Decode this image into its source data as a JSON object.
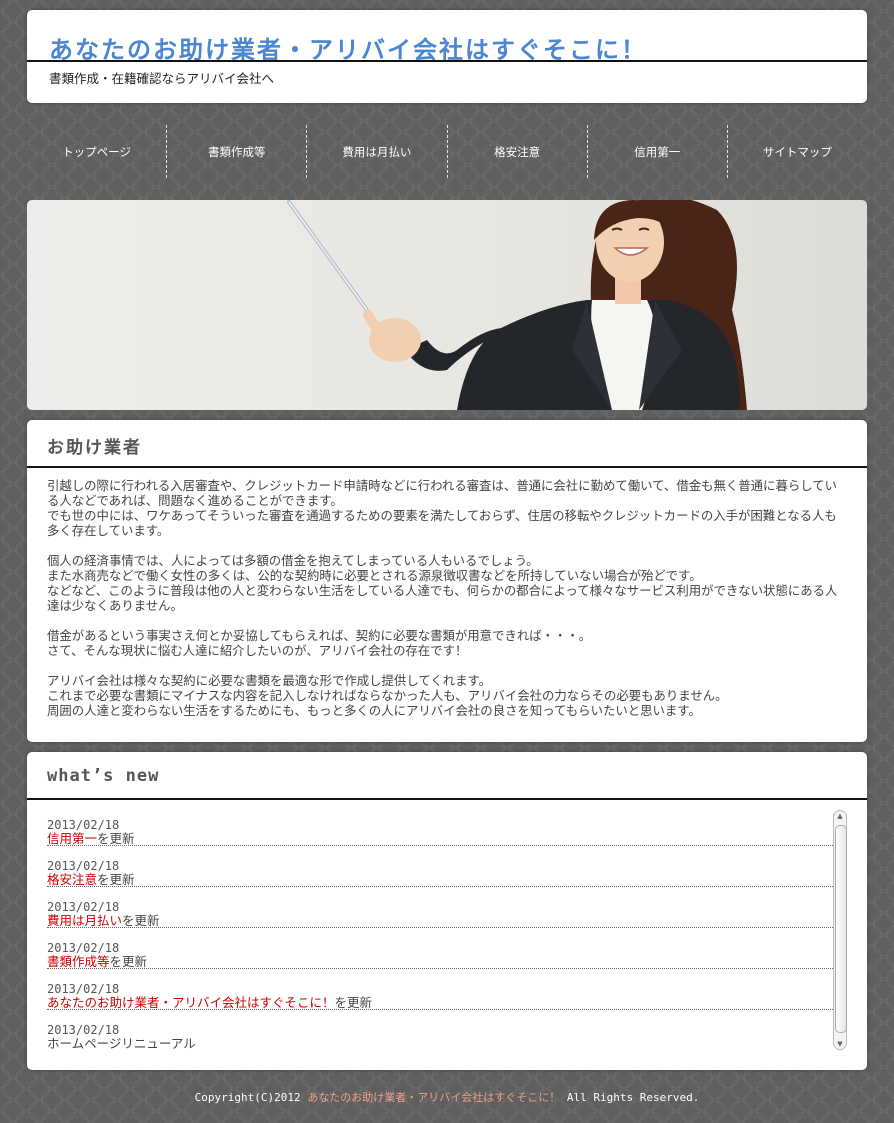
{
  "header": {
    "title": "あなたのお助け業者・アリバイ会社はすぐそこに！",
    "subtitle": "書類作成・在籍確認ならアリバイ会社へ"
  },
  "nav": {
    "items": [
      {
        "label": "トップページ"
      },
      {
        "label": "書類作成等"
      },
      {
        "label": "費用は月払い"
      },
      {
        "label": "格安注意"
      },
      {
        "label": "信用第一"
      },
      {
        "label": "サイトマップ"
      }
    ]
  },
  "article": {
    "heading": "お助け業者",
    "paragraphs": [
      [
        "引越しの際に行われる入居審査や、クレジットカード申請時などに行われる審査は、普通に会社に勤めて働いて、借金も無く普通に暮らしている人などであれば、問題なく進めることができます。",
        "でも世の中には、ワケあってそういった審査を通過するための要素を満たしておらず、住居の移転やクレジットカードの入手が困難となる人も多く存在しています。"
      ],
      [
        "個人の経済事情では、人によっては多額の借金を抱えてしまっている人もいるでしょう。",
        "また水商売などで働く女性の多くは、公的な契約時に必要とされる源泉徴収書などを所持していない場合が殆どです。",
        "などなど、このように普段は他の人と変わらない生活をしている人達でも、何らかの都合によって様々なサービス利用ができない状態にある人達は少なくありません。"
      ],
      [
        "借金があるという事実さえ何とか妥協してもらえれば、契約に必要な書類が用意できれば・・・。",
        "さて、そんな現状に悩む人達に紹介したいのが、アリバイ会社の存在です！"
      ],
      [
        "アリバイ会社は様々な契約に必要な書類を最適な形で作成し提供してくれます。",
        "これまで必要な書類にマイナスな内容を記入しなければならなかった人も、アリバイ会社の力ならその必要もありません。",
        "周囲の人達と変わらない生活をするためにも、もっと多くの人にアリバイ会社の良さを知ってもらいたいと思います。"
      ]
    ]
  },
  "news": {
    "heading": "what’s new",
    "suffix": "を更新",
    "items": [
      {
        "date": "2013/02/18",
        "link": "信用第一",
        "suffix": "を更新"
      },
      {
        "date": "2013/02/18",
        "link": "格安注意",
        "suffix": "を更新"
      },
      {
        "date": "2013/02/18",
        "link": "費用は月払い",
        "suffix": "を更新"
      },
      {
        "date": "2013/02/18",
        "link": "書類作成等",
        "suffix": "を更新"
      },
      {
        "date": "2013/02/18",
        "link": "あなたのお助け業者・アリバイ会社はすぐそこに！",
        "suffix": "を更新"
      },
      {
        "date": "2013/02/18",
        "link": "",
        "suffix": "ホームページリニューアル"
      }
    ]
  },
  "footer": {
    "prefix": "Copyright(C)2012",
    "site_name": "あなたのお助け業者・アリバイ会社はすぐそこに！",
    "suffix": "All Rights Reserved."
  },
  "colors": {
    "title": "#4a86d1",
    "link": "#cc0000",
    "footer_link": "#f2a08c",
    "background": "#5f5f5f"
  }
}
